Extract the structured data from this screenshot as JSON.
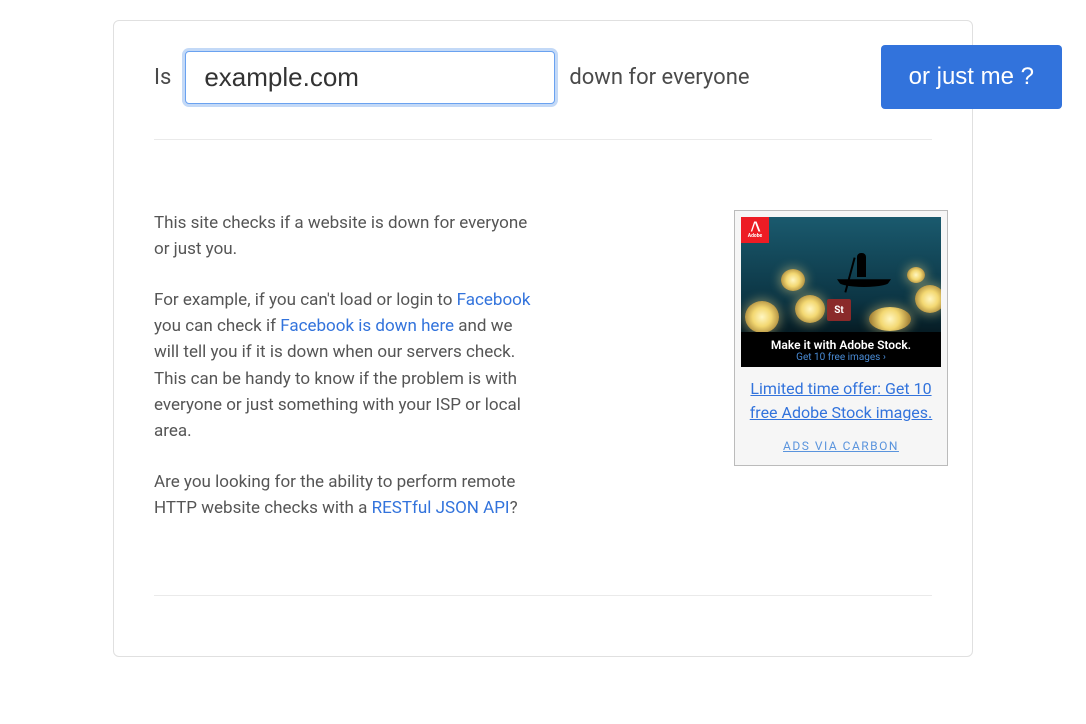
{
  "form": {
    "prefix": "Is",
    "input_value": "example.com",
    "suffix": "down for everyone",
    "button": "or just me ?"
  },
  "description": {
    "p1": "This site checks if a website is down for everyone or just you.",
    "p2a": "For example, if you can't load or login to ",
    "p2_link1": "Facebook",
    "p2b": " you can check if ",
    "p2_link2": "Facebook is down here",
    "p2c": " and we will tell you if it is down when our servers check. This can be handy to know if the problem is with everyone or just something with your ISP or local area.",
    "p3a": "Are you looking for the ability to perform remote HTTP website checks with a ",
    "p3_link": "RESTful JSON API",
    "p3b": "?"
  },
  "ad": {
    "overlay_title": "Make it with Adobe Stock.",
    "overlay_sub": "Get 10 free images ›",
    "caption": "Limited time offer: Get 10 free Adobe Stock images.",
    "via": "ADS VIA CARBON",
    "badge_st": "St"
  }
}
